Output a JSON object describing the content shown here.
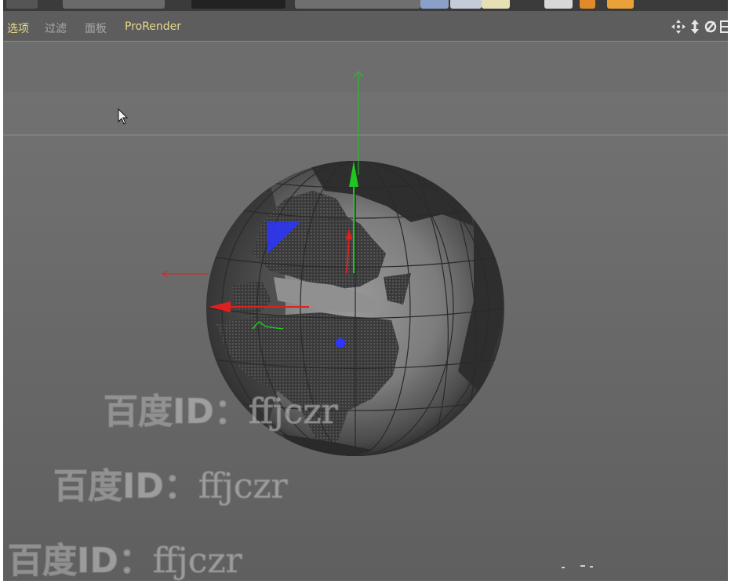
{
  "menubar": {
    "items": [
      {
        "label": "选项",
        "active": true
      },
      {
        "label": "过滤",
        "active": false
      },
      {
        "label": "面板",
        "active": false
      },
      {
        "label": "ProRender",
        "active": true
      }
    ],
    "nav_icons": [
      "move-view-icon",
      "dolly-view-icon",
      "rotate-view-icon",
      "toggle-layout-icon"
    ]
  },
  "watermark": {
    "prefix": "百度ID：",
    "handle": "ffjczr"
  },
  "colors": {
    "accent_text": "#e6d88a",
    "menu_text": "#a9a9a9",
    "axis_x": "#e0201e",
    "axis_y": "#20c520",
    "axis_z": "#2c36ff"
  }
}
